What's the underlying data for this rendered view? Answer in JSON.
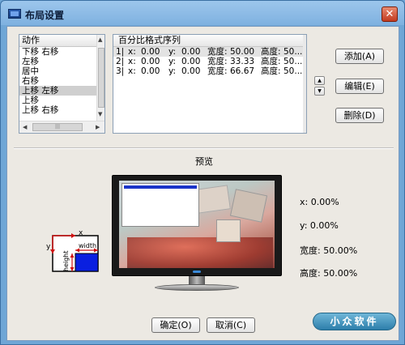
{
  "window": {
    "title": "布局设置",
    "close_glyph": "✕"
  },
  "action_list": {
    "header": "动作",
    "items": [
      "下移 右移",
      "左移",
      "居中",
      "右移",
      "上移 左移",
      "上移",
      "上移 右移"
    ],
    "selected_index": 4
  },
  "format_list": {
    "header": "百分比格式序列",
    "rows": [
      {
        "idx": "1|",
        "x_label": "x:",
        "x": "0.00",
        "y_label": "y:",
        "y": "0.00",
        "w_label": "宽度:",
        "w": "50.00",
        "h_label": "高度:",
        "h": "50..."
      },
      {
        "idx": "2|",
        "x_label": "x:",
        "x": "0.00",
        "y_label": "y:",
        "y": "0.00",
        "w_label": "宽度:",
        "w": "33.33",
        "h_label": "高度:",
        "h": "50..."
      },
      {
        "idx": "3|",
        "x_label": "x:",
        "x": "0.00",
        "y_label": "y:",
        "y": "0.00",
        "w_label": "宽度:",
        "w": "66.67",
        "h_label": "高度:",
        "h": "50..."
      }
    ]
  },
  "buttons": {
    "add": "添加(A)",
    "edit": "编辑(E)",
    "delete": "删除(D)",
    "ok": "确定(O)",
    "cancel": "取消(C)"
  },
  "preview": {
    "label": "预览",
    "x_text": "x: 0.00%",
    "y_text": "y: 0.00%",
    "width_text": "宽度: 50.00%",
    "height_text": "高度: 50.00%"
  },
  "diagram": {
    "x_label": "x",
    "y_label": "y",
    "width_label": "width",
    "height_label": "height"
  },
  "brand": "小众软件",
  "colors": {
    "title_bg": "#7fb1e0",
    "client_bg": "#ece9e3",
    "selection": "#cfcfcf",
    "preview_rect_bar": "#1a34c8",
    "brand_bg": "#2d7eaa"
  }
}
